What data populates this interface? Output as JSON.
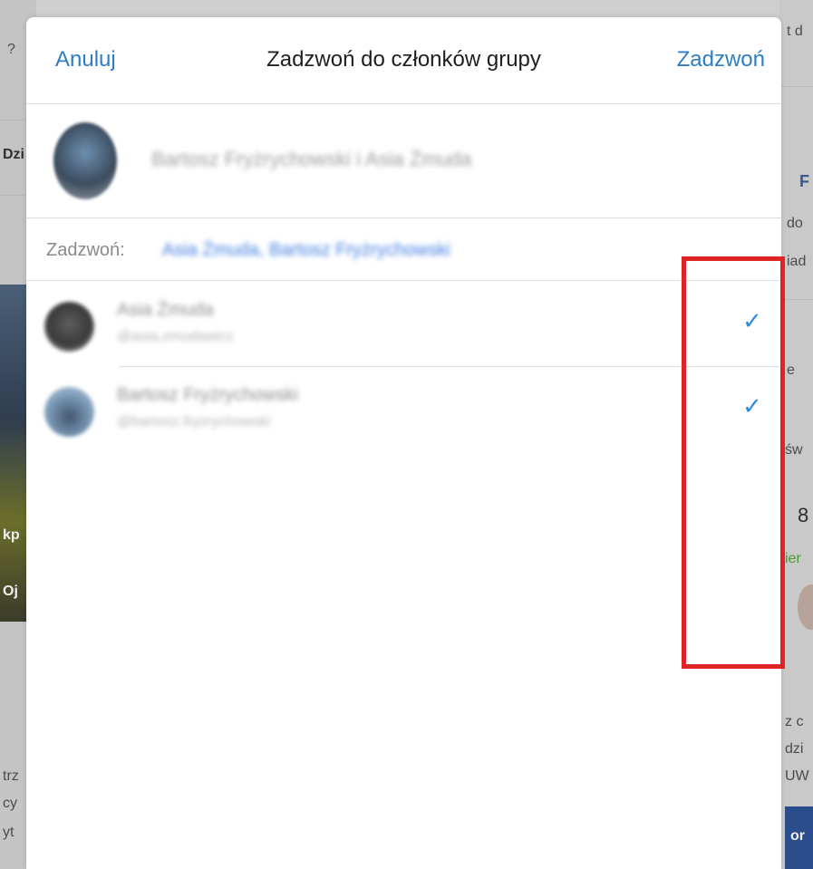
{
  "background": {
    "left_fragments": [
      "?",
      "Dzi",
      "kp",
      "Oj",
      "trz",
      "cy",
      "yt"
    ],
    "right_fragments": [
      "t d",
      "F",
      "do",
      "iad",
      "e",
      "św",
      "8",
      "ier",
      "z c",
      "dzi",
      "UW",
      "or"
    ]
  },
  "modal": {
    "cancel_label": "Anuluj",
    "title": "Zadzwoń do członków grupy",
    "call_label": "Zadzwoń",
    "group": {
      "name": "Bartosz Fryżrychowski i Asia Żmuda"
    },
    "recipients": {
      "label": "Zadzwoń:",
      "value": "Asia Żmuda, Bartosz Fryżrychowski"
    },
    "members": [
      {
        "name": "Asia Żmuda",
        "subtitle": "@asia.zmudawicz",
        "check": "✓"
      },
      {
        "name": "Bartosz Fryżrychowski",
        "subtitle": "@bartosz.fryzrychowski",
        "check": "✓"
      }
    ]
  },
  "colors": {
    "accent": "#2d7ec6",
    "check": "#2d8ce0",
    "highlight": "#e02424"
  },
  "icons": {
    "check": "checkmark-icon",
    "avatar": "avatar"
  }
}
